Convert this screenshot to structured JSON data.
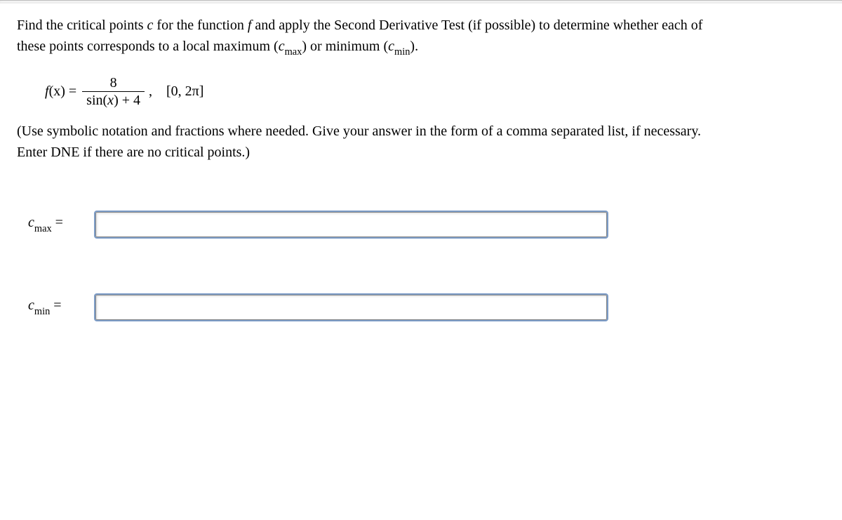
{
  "question": {
    "line1_a": "Find the critical points ",
    "line1_var": "c",
    "line1_b": " for the function ",
    "line1_fn": "f",
    "line1_c": " and apply the Second Derivative Test (if possible) to determine whether each of",
    "line2_a": "these points corresponds to a local maximum (",
    "line2_cmax_c": "c",
    "line2_cmax_sub": "max",
    "line2_b": ") or minimum (",
    "line2_cmin_c": "c",
    "line2_cmin_sub": "min",
    "line2_c": ")."
  },
  "formula": {
    "lhs_f": "f",
    "lhs_x": "(x)",
    "equals": " = ",
    "numerator": "8",
    "den_a": "sin(",
    "den_x": "x",
    "den_b": ") + 4",
    "comma": ",",
    "interval": "[0, 2π]"
  },
  "instructions": {
    "line1": "(Use symbolic notation and fractions where needed. Give your answer in the form of a comma separated list, if necessary.",
    "line2": "Enter DNE if there are no critical points.)"
  },
  "answers": {
    "cmax": {
      "c": "c",
      "sub": "max",
      "eq": " =",
      "value": ""
    },
    "cmin": {
      "c": "c",
      "sub": "min",
      "eq": " =",
      "value": ""
    }
  }
}
